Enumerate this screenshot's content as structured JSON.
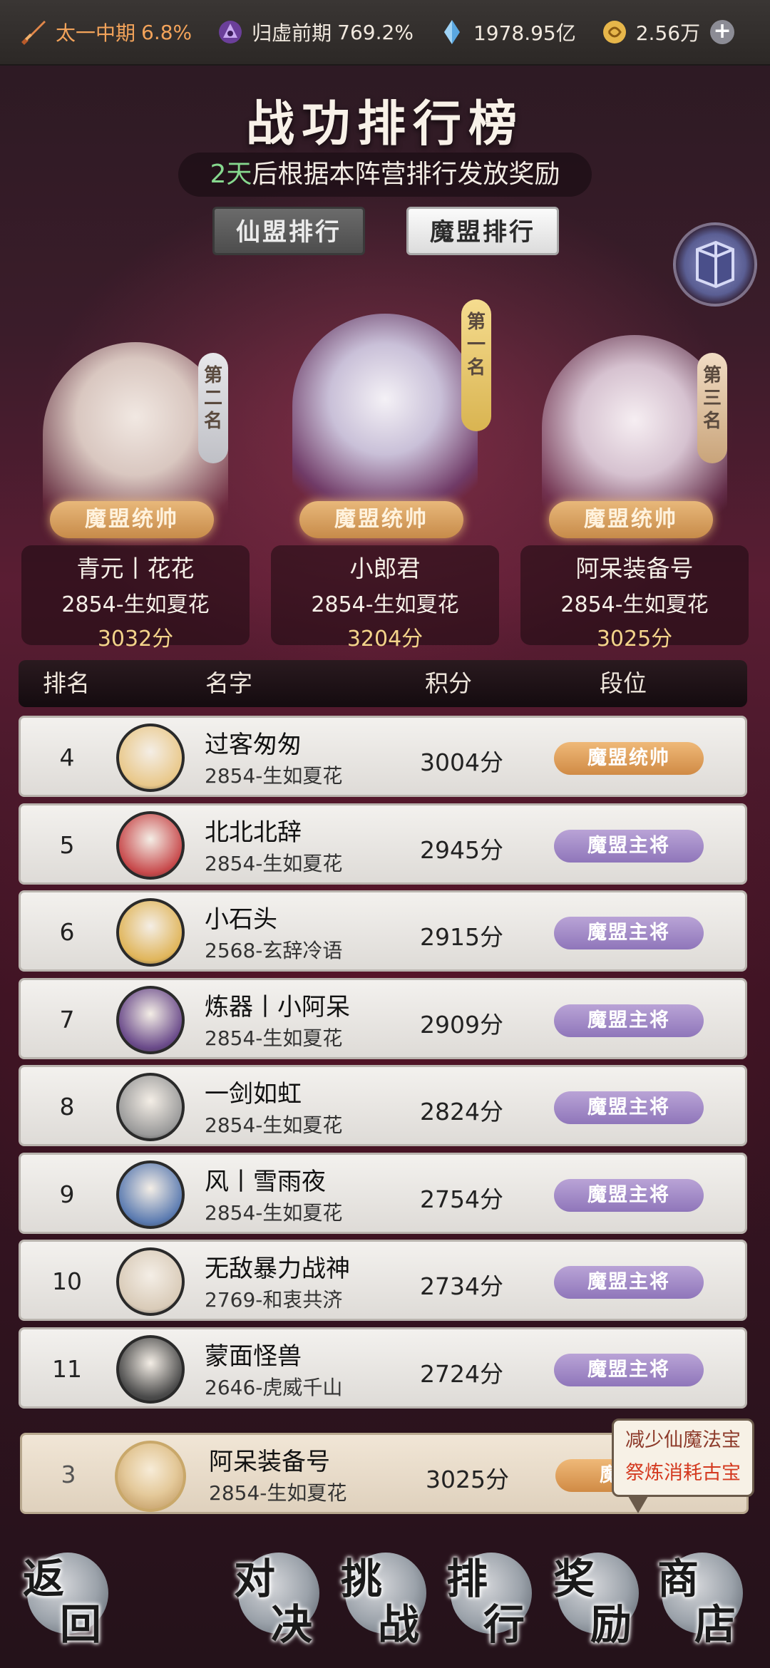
{
  "topbar": {
    "realm_label": "太一中期",
    "realm_pct": "6.8%",
    "stage_label": "归虚前期",
    "stage_pct": "769.2%",
    "crystal": "1978.95亿",
    "coin": "2.56万",
    "icons": [
      "sword-icon",
      "demon-sigil-icon",
      "crystal-icon",
      "coin-icon",
      "plus-icon"
    ]
  },
  "page_title": "战功排行榜",
  "notice": {
    "days": "2天",
    "text": "后根据本阵营排行发放奖励"
  },
  "tabs": [
    {
      "label": "仙盟排行",
      "active": false
    },
    {
      "label": "魔盟排行",
      "active": true
    }
  ],
  "podium": [
    {
      "rank_label": "第二名",
      "title": "魔盟统帅",
      "name": "青元丨花花",
      "server": "2854-生如夏花",
      "score": "3032分"
    },
    {
      "rank_label": "第一名",
      "title": "魔盟统帅",
      "name": "小郎君",
      "server": "2854-生如夏花",
      "score": "3204分"
    },
    {
      "rank_label": "第三名",
      "title": "魔盟统帅",
      "name": "阿呆装备号",
      "server": "2854-生如夏花",
      "score": "3025分"
    }
  ],
  "table": {
    "headers": [
      "排名",
      "名字",
      "积分",
      "段位"
    ],
    "rows": [
      {
        "rank": "4",
        "name": "过客匆匆",
        "server": "2854-生如夏花",
        "score": "3004分",
        "tier": "魔盟统帅",
        "tier_color": "gold"
      },
      {
        "rank": "5",
        "name": "北北北辞",
        "server": "2854-生如夏花",
        "score": "2945分",
        "tier": "魔盟主将",
        "tier_color": "purple"
      },
      {
        "rank": "6",
        "name": "小石头",
        "server": "2568-玄辞冷语",
        "score": "2915分",
        "tier": "魔盟主将",
        "tier_color": "purple"
      },
      {
        "rank": "7",
        "name": "炼器丨小阿呆",
        "server": "2854-生如夏花",
        "score": "2909分",
        "tier": "魔盟主将",
        "tier_color": "purple"
      },
      {
        "rank": "8",
        "name": "一剑如虹",
        "server": "2854-生如夏花",
        "score": "2824分",
        "tier": "魔盟主将",
        "tier_color": "purple"
      },
      {
        "rank": "9",
        "name": "风丨雪雨夜",
        "server": "2854-生如夏花",
        "score": "2754分",
        "tier": "魔盟主将",
        "tier_color": "purple"
      },
      {
        "rank": "10",
        "name": "无敌暴力战神",
        "server": "2769-和衷共济",
        "score": "2734分",
        "tier": "魔盟主将",
        "tier_color": "purple"
      },
      {
        "rank": "11",
        "name": "蒙面怪兽",
        "server": "2646-虎威千山",
        "score": "2724分",
        "tier": "魔盟主将",
        "tier_color": "purple"
      }
    ]
  },
  "my_row": {
    "rank": "3",
    "name": "阿呆装备号",
    "server": "2854-生如夏花",
    "score": "3025分",
    "tier_partial": "魔"
  },
  "tooltip": {
    "line1": "减少仙魔法宝",
    "line2": "祭炼消耗古宝"
  },
  "nav": [
    {
      "c1": "返",
      "c2": "回"
    },
    {
      "c1": "对",
      "c2": "决"
    },
    {
      "c1": "挑",
      "c2": "战"
    },
    {
      "c1": "排",
      "c2": "行"
    },
    {
      "c1": "奖",
      "c2": "励"
    },
    {
      "c1": "商",
      "c2": "店"
    }
  ],
  "colors": {
    "gold_badge": "#d08b45",
    "purple_badge": "#8f76ba",
    "accent_orange": "#f3a35a",
    "notice_green": "#86d88e"
  }
}
